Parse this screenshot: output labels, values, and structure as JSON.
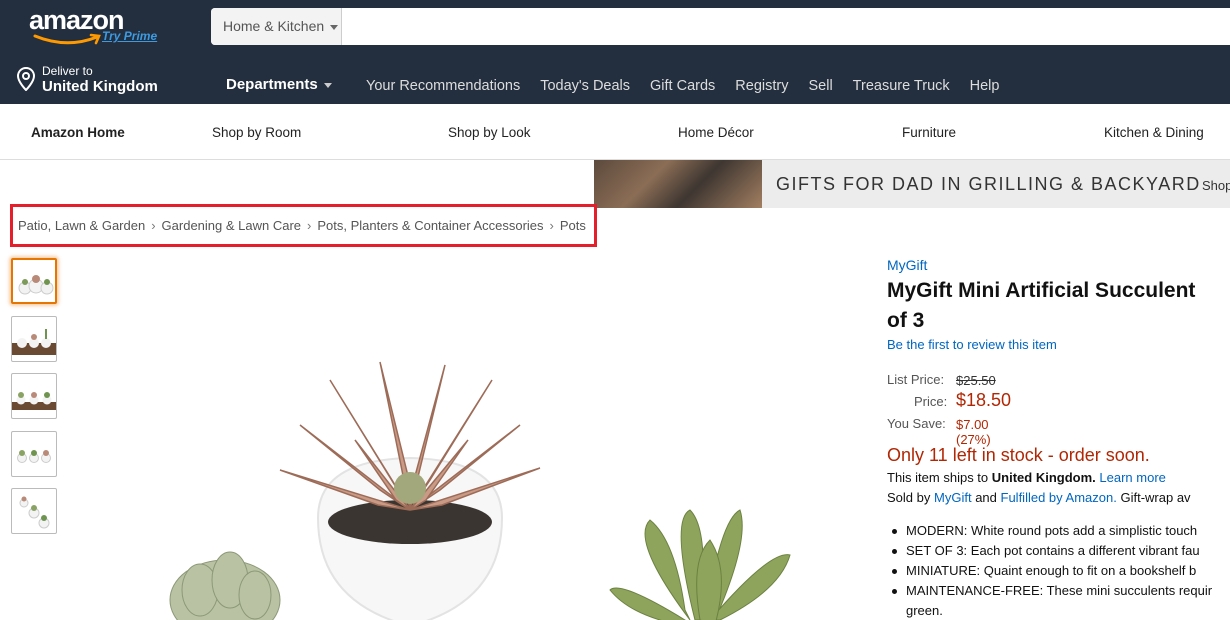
{
  "header": {
    "logo_text": "amazon",
    "logo_prime": "Try Prime",
    "search_category": "Home & Kitchen",
    "search_placeholder": "",
    "deliver_line1": "Deliver to",
    "deliver_line2": "United Kingdom",
    "departments": "Departments",
    "nav_links": [
      "Your Recommendations",
      "Today's Deals",
      "Gift Cards",
      "Registry",
      "Sell",
      "Treasure Truck",
      "Help"
    ]
  },
  "store_nav": {
    "home": "Amazon Home",
    "items": [
      "Shop by Room",
      "Shop by Look",
      "Home Décor",
      "Furniture",
      "Kitchen & Dining"
    ]
  },
  "banner": {
    "text": "GIFTS FOR DAD IN GRILLING & BACKYARD",
    "shop": "Shop"
  },
  "breadcrumb": [
    "Patio, Lawn & Garden",
    "Gardening & Lawn Care",
    "Pots, Planters & Container Accessories",
    "Pots"
  ],
  "breadcrumb_sep": "›",
  "product": {
    "brand": "MyGift",
    "title_line1": "MyGift Mini Artificial Succulent",
    "title_line2": "of 3",
    "review_link": "Be the first to review this item",
    "list_price_label": "List Price:",
    "list_price": "$25.50",
    "price_label": "Price:",
    "price": "$18.50",
    "save_label": "You Save:",
    "save": "$7.00 (27%)",
    "stock": "Only 11 left in stock - order soon.",
    "ships_prefix": "This item ships to",
    "ships_country": "United Kingdom.",
    "learn_more": "Learn more",
    "sold_by": "Sold by",
    "seller": "MyGift",
    "and": "and",
    "fulfilled": "Fulfilled by Amazon.",
    "gift_wrap": "Gift-wrap av",
    "bullets": [
      "MODERN: White round pots add a simplistic touch",
      "SET OF 3: Each pot contains a different vibrant fau",
      "MINIATURE: Quaint enough to fit on a bookshelf b",
      "MAINTENANCE-FREE: These mini succulents requir"
    ],
    "bullet_cont": "green."
  },
  "colors": {
    "header_bg": "#232f3e",
    "link": "#0066c0",
    "price_red": "#b12704",
    "highlight_box": "#e41e2b",
    "thumb_selected": "#e77600"
  }
}
